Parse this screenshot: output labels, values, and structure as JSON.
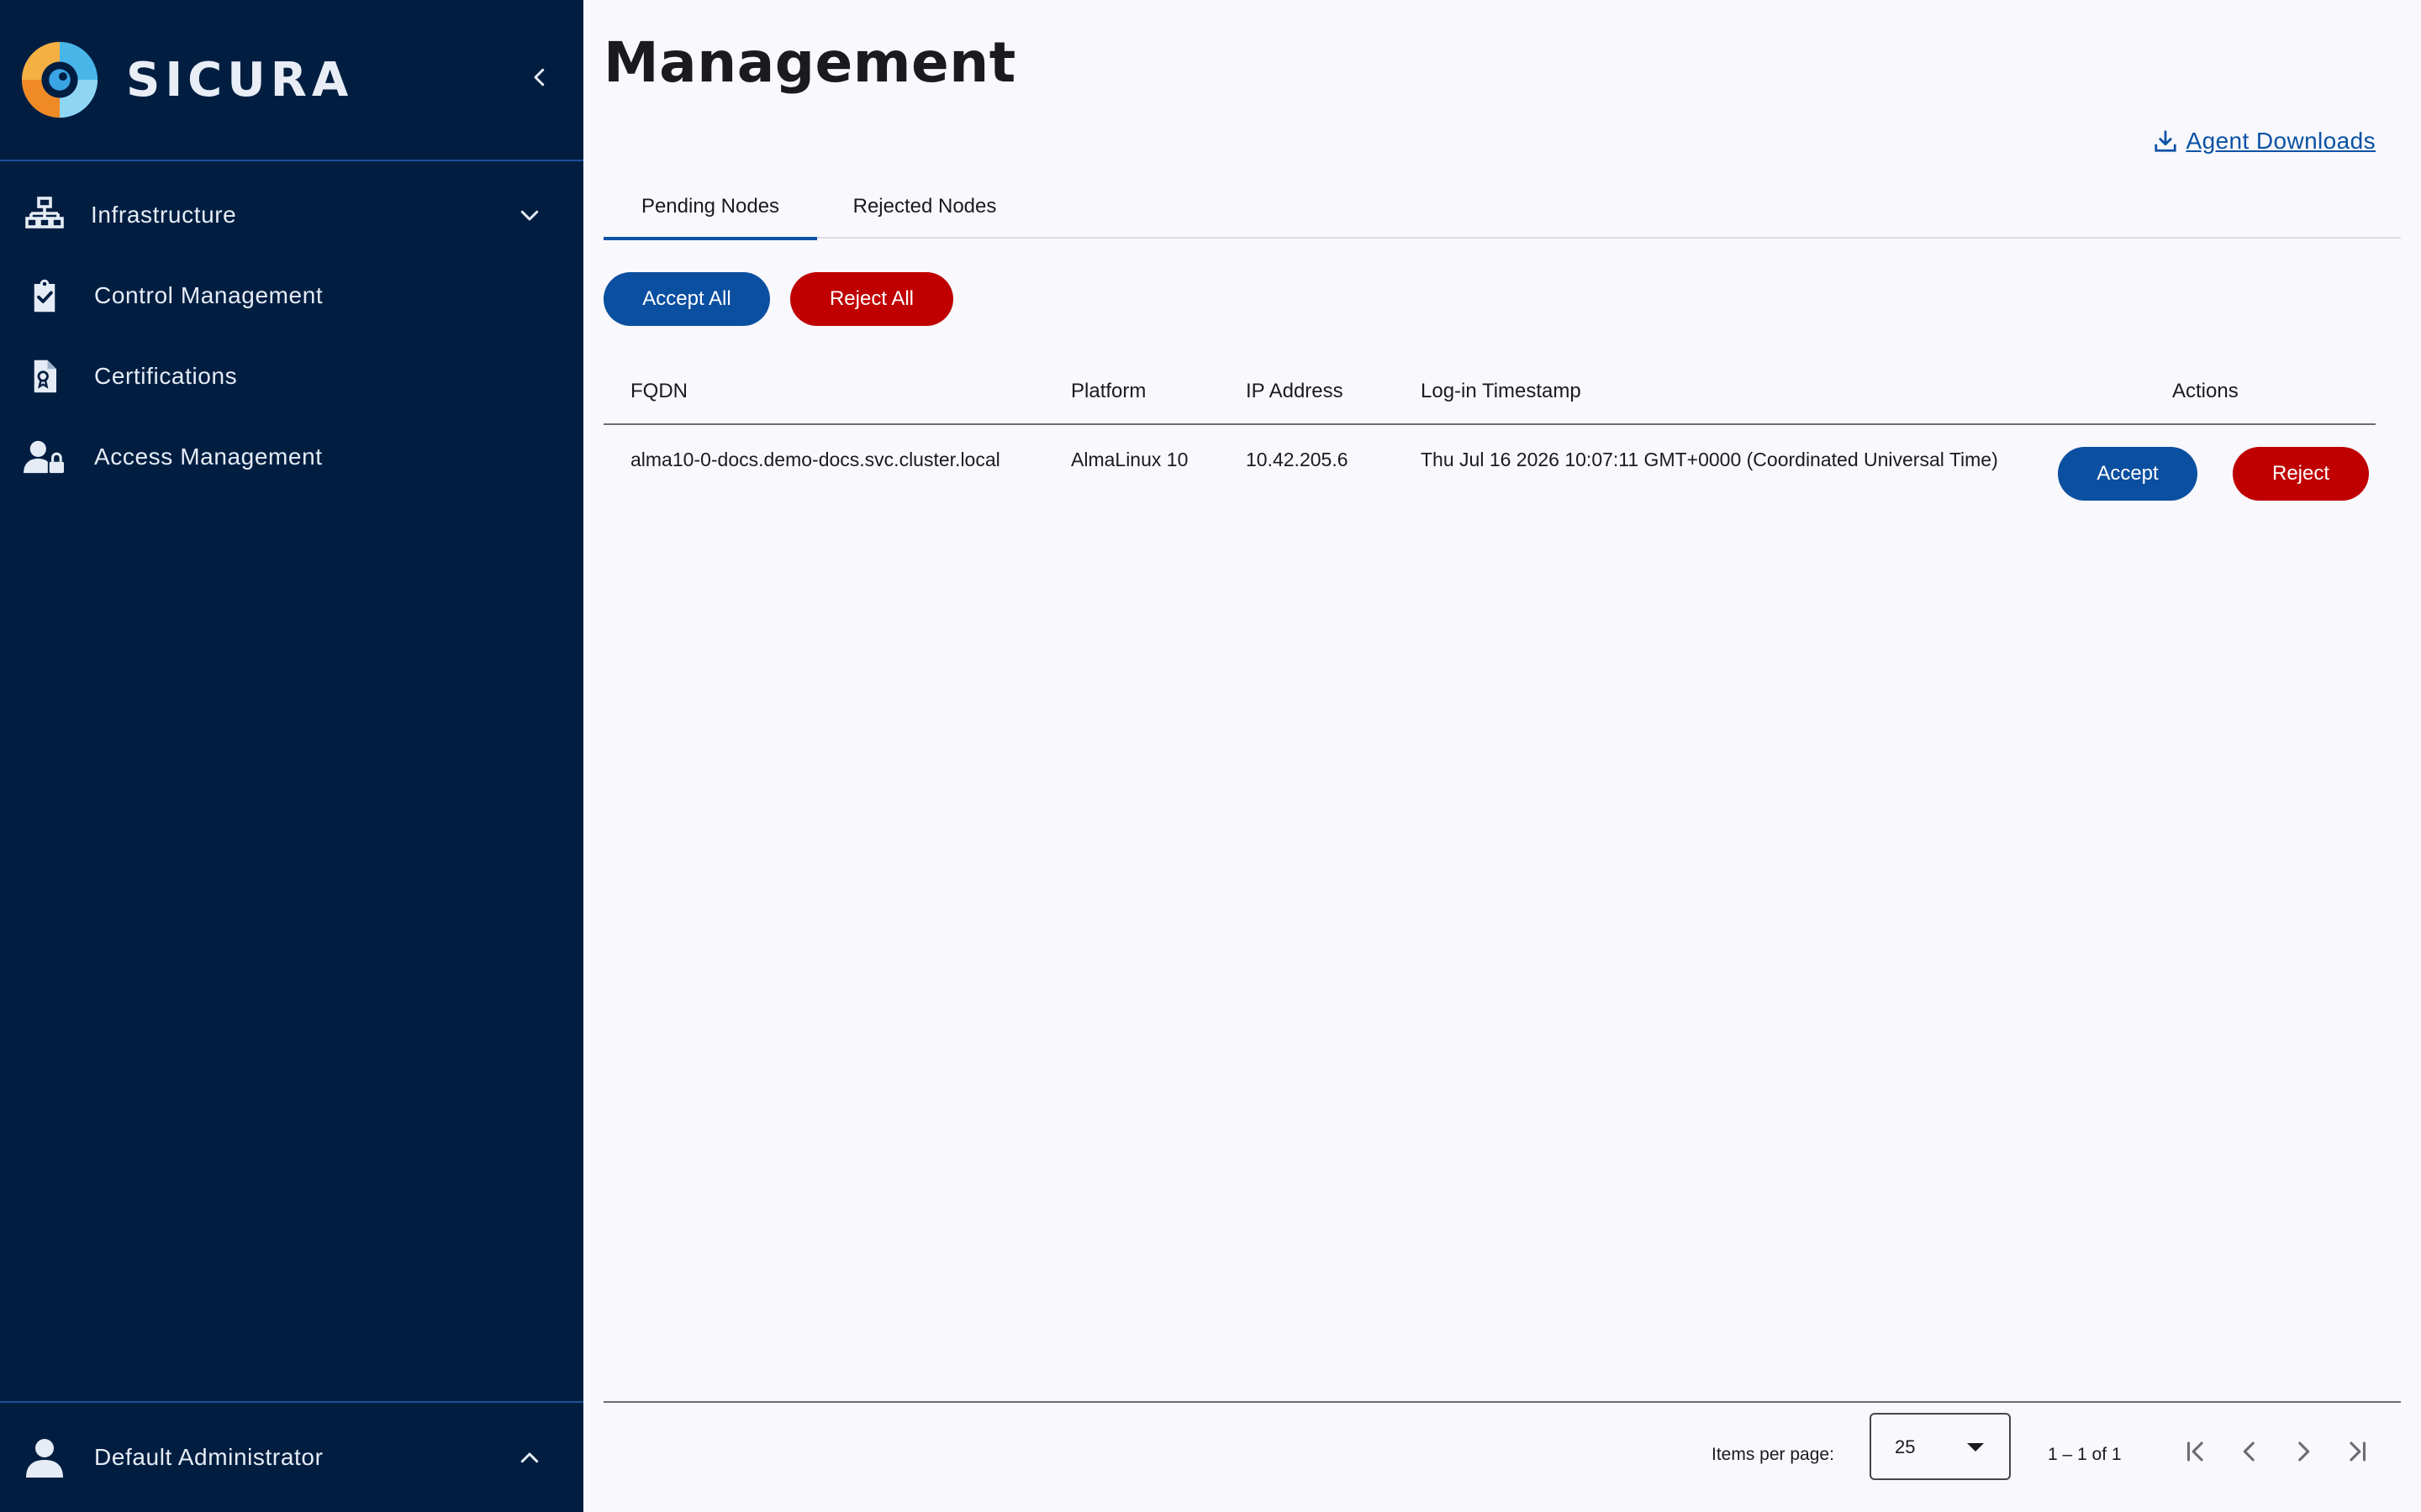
{
  "brand": {
    "name": "SICURA"
  },
  "sidebar": {
    "items": [
      {
        "label": "Infrastructure",
        "icon": "network-icon"
      },
      {
        "label": "Control Management",
        "icon": "clipboard-check-icon"
      },
      {
        "label": "Certifications",
        "icon": "certificate-document-icon"
      },
      {
        "label": "Access Management",
        "icon": "user-lock-icon"
      }
    ],
    "user": {
      "name": "Default Administrator",
      "icon": "user-icon"
    }
  },
  "page": {
    "title": "Management",
    "agent_downloads": "Agent Downloads"
  },
  "tabs": [
    {
      "label": "Pending Nodes",
      "active": true
    },
    {
      "label": "Rejected Nodes",
      "active": false
    }
  ],
  "actions": {
    "accept_all": "Accept All",
    "reject_all": "Reject All"
  },
  "table": {
    "columns": [
      "FQDN",
      "Platform",
      "IP Address",
      "Log-in Timestamp",
      "Actions"
    ],
    "rows": [
      {
        "fqdn": "alma10-0-docs.demo-docs.svc.cluster.local",
        "platform": "AlmaLinux 10",
        "ip": "10.42.205.6",
        "timestamp": "Thu Jul 16 2026 10:07:11 GMT+0000 (Coordinated Universal Time)",
        "accept": "Accept",
        "reject": "Reject"
      }
    ]
  },
  "paginator": {
    "items_per_page_label": "Items per page:",
    "items_per_page": "25",
    "range": "1 – 1 of 1"
  },
  "colors": {
    "sidebar_bg": "#011e41",
    "primary": "#0b4fa0",
    "danger": "#c00000",
    "link": "#0b52a5"
  }
}
